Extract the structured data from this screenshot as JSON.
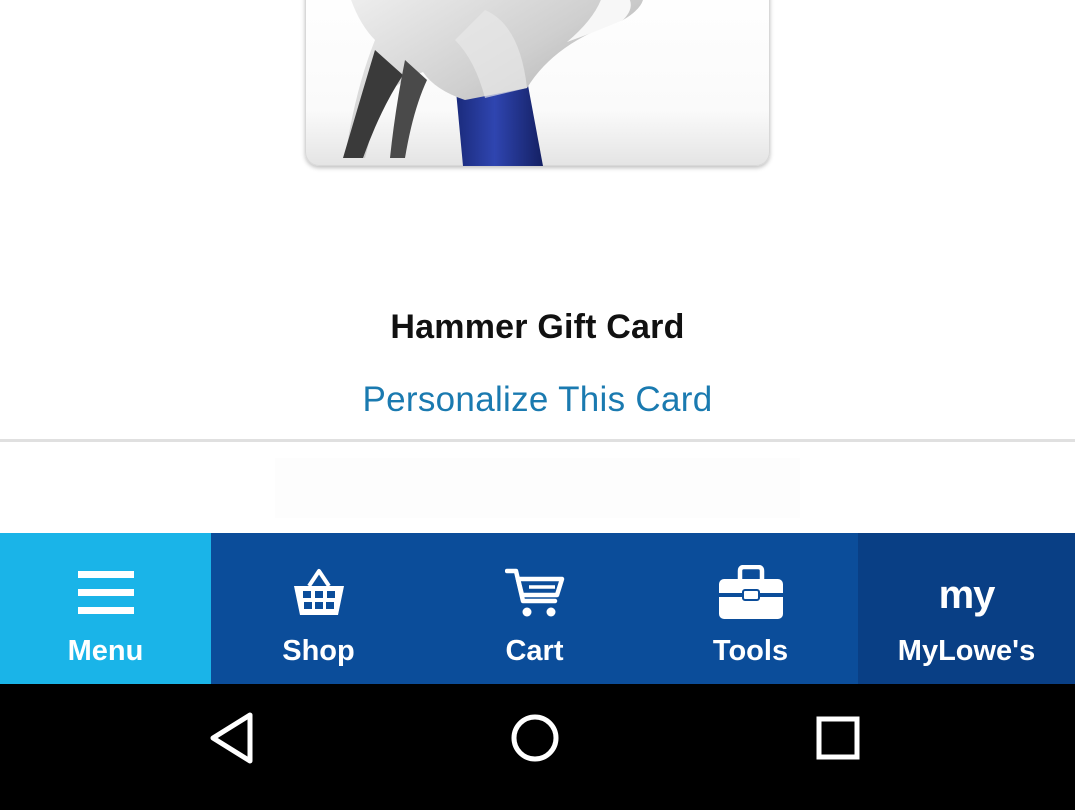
{
  "product": {
    "title": "Hammer Gift Card",
    "personalize_link": "Personalize This Card"
  },
  "bottom_nav": {
    "items": [
      {
        "label": "Menu",
        "icon": "hamburger-menu-icon"
      },
      {
        "label": "Shop",
        "icon": "shopping-basket-icon"
      },
      {
        "label": "Cart",
        "icon": "shopping-cart-icon"
      },
      {
        "label": "Tools",
        "icon": "toolbox-icon"
      },
      {
        "label": "MyLowe's",
        "icon": "my-glyph",
        "icon_text": "my"
      }
    ]
  },
  "system_nav": {
    "buttons": [
      "back-icon",
      "home-icon",
      "recents-icon"
    ]
  },
  "colors": {
    "link": "#1a7ab0",
    "nav_active": "#1ab4e8",
    "nav_bg": "#0b4d9a",
    "nav_mylowes_bg": "#093f85",
    "system_bar": "#000000"
  }
}
